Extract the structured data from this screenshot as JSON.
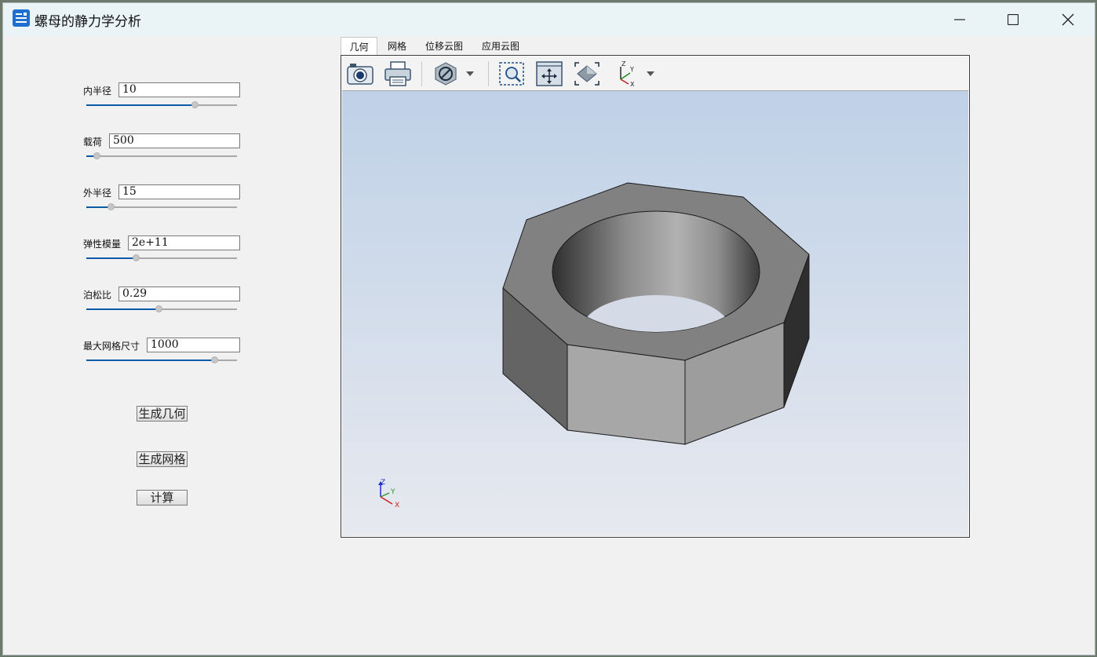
{
  "window": {
    "title": "螺母的静力学分析",
    "controls": [
      "minimize-icon",
      "maximize-icon",
      "close-icon"
    ]
  },
  "params": {
    "inner_radius": {
      "label": "内半径",
      "value": "10",
      "level": 0.72
    },
    "load": {
      "label": "载荷",
      "value": "500",
      "level": 0.07
    },
    "outer_radius": {
      "label": "外半径",
      "value": "15",
      "level": 0.16
    },
    "elastic_modulus": {
      "label": "弹性模量",
      "value": "2e+11",
      "level": 0.33
    },
    "poisson_ratio": {
      "label": "泊松比",
      "value": "0.29",
      "level": 0.48
    },
    "max_mesh_size": {
      "label": "最大网格尺寸",
      "value": "1000",
      "level": 0.85
    }
  },
  "buttons": {
    "generate_geometry": "生成几何",
    "generate_mesh": "生成网格",
    "compute": "计算"
  },
  "tabs": [
    "几何",
    "网格",
    "位移云图",
    "应用云图"
  ],
  "active_tab": "几何",
  "toolbar": {
    "icons": [
      "camera-icon",
      "print-icon",
      "display-mode-icon",
      "dropdown-icon",
      "zoom-box-icon",
      "pan-icon",
      "fit-view-icon",
      "axis-view-icon",
      "dropdown-icon"
    ]
  },
  "triad": {
    "x": "X",
    "y": "Y",
    "z": "Z"
  },
  "colors": {
    "accent": "#0a5aa8",
    "viewport_top": "#bfd1e7",
    "viewport_bottom": "#e7e9ef"
  }
}
